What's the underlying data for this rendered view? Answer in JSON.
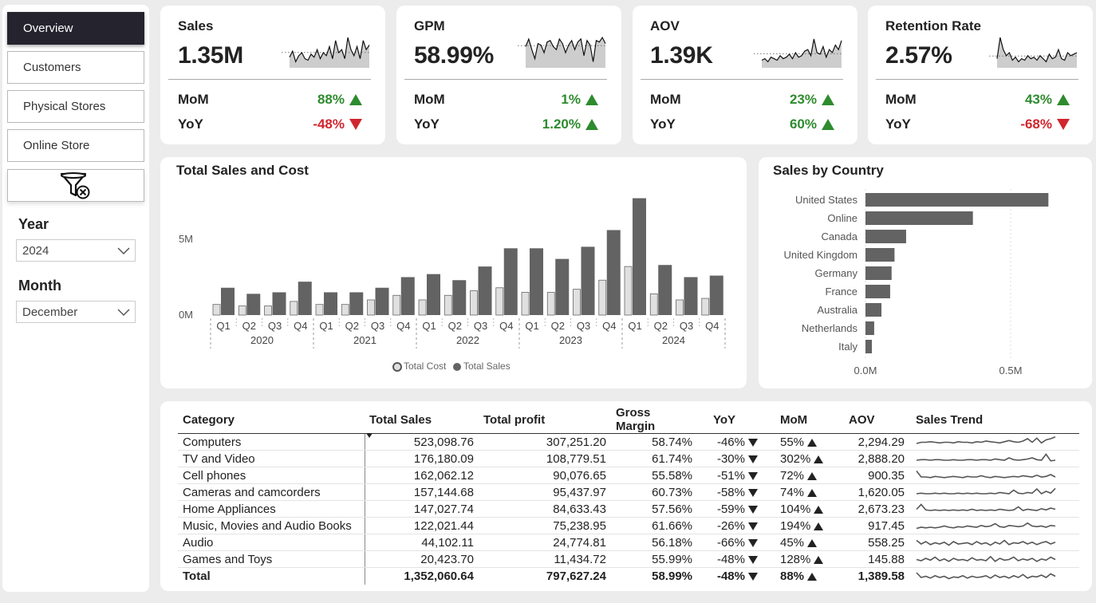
{
  "nav": {
    "items": [
      {
        "label": "Overview",
        "active": true
      },
      {
        "label": "Customers",
        "active": false
      },
      {
        "label": "Physical Stores",
        "active": false
      },
      {
        "label": "Online Store",
        "active": false
      }
    ],
    "clear_filter_icon": "funnel-clear-icon"
  },
  "filters": {
    "year": {
      "label": "Year",
      "value": "2024"
    },
    "month": {
      "label": "Month",
      "value": "December"
    }
  },
  "kpis": [
    {
      "title": "Sales",
      "value": "1.35M",
      "mom_label": "MoM",
      "mom": "88%",
      "mom_dir": "up",
      "yoy_label": "YoY",
      "yoy": "-48%",
      "yoy_dir": "down",
      "trend": [
        0.35,
        0.55,
        0.2,
        0.4,
        0.5,
        0.3,
        0.25,
        0.45,
        0.35,
        0.6,
        0.3,
        0.5,
        0.4,
        0.7,
        0.3,
        0.9,
        0.5,
        0.6,
        0.3,
        1.0,
        0.6,
        0.4,
        0.7,
        0.3,
        0.9,
        0.6,
        0.75
      ]
    },
    {
      "title": "GPM",
      "value": "58.99%",
      "mom_label": "MoM",
      "mom": "1%",
      "mom_dir": "up",
      "yoy_label": "YoY",
      "yoy": "1.20%",
      "yoy_dir": "up",
      "trend": [
        0.7,
        0.95,
        0.6,
        0.3,
        0.8,
        0.75,
        0.5,
        0.85,
        0.9,
        0.7,
        0.6,
        0.95,
        0.8,
        0.5,
        0.75,
        0.9,
        0.6,
        0.85,
        0.95,
        0.4,
        0.9,
        0.75,
        0.2,
        0.9,
        0.85,
        1.0,
        0.8
      ]
    },
    {
      "title": "AOV",
      "value": "1.39K",
      "mom_label": "MoM",
      "mom": "23%",
      "mom_dir": "up",
      "yoy_label": "YoY",
      "yoy": "60%",
      "yoy_dir": "up",
      "trend": [
        0.25,
        0.3,
        0.2,
        0.35,
        0.3,
        0.25,
        0.4,
        0.3,
        0.35,
        0.45,
        0.3,
        0.5,
        0.35,
        0.4,
        0.55,
        0.6,
        0.4,
        0.95,
        0.5,
        0.45,
        0.7,
        0.35,
        0.6,
        0.5,
        0.75,
        0.6,
        0.9
      ]
    },
    {
      "title": "Retention Rate",
      "value": "2.57%",
      "mom_label": "MoM",
      "mom": "43%",
      "mom_dir": "up",
      "yoy_label": "YoY",
      "yoy": "-68%",
      "yoy_dir": "down",
      "trend": [
        0.3,
        1.0,
        0.6,
        0.4,
        0.5,
        0.25,
        0.35,
        0.2,
        0.3,
        0.25,
        0.4,
        0.3,
        0.35,
        0.25,
        0.4,
        0.3,
        0.2,
        0.45,
        0.3,
        0.35,
        0.6,
        0.3,
        0.25,
        0.5,
        0.4,
        0.45,
        0.5
      ]
    }
  ],
  "chart_data": [
    {
      "type": "bar",
      "title": "Total Sales and Cost",
      "y_tick_labels": [
        "0M",
        "5M"
      ],
      "ylim": [
        0,
        8.2
      ],
      "quarters": [
        "Q1",
        "Q2",
        "Q3",
        "Q4",
        "Q1",
        "Q2",
        "Q3",
        "Q4",
        "Q1",
        "Q2",
        "Q3",
        "Q4",
        "Q1",
        "Q2",
        "Q3",
        "Q4",
        "Q1",
        "Q2",
        "Q3",
        "Q4"
      ],
      "years": [
        "2020",
        "2021",
        "2022",
        "2023",
        "2024"
      ],
      "series": [
        {
          "name": "Total Cost",
          "color": "#e0e0e0",
          "values": [
            0.7,
            0.6,
            0.6,
            0.9,
            0.7,
            0.7,
            1.0,
            1.3,
            1.0,
            1.3,
            1.6,
            1.8,
            1.5,
            1.5,
            1.7,
            2.3,
            3.2,
            1.4,
            1.0,
            1.1
          ]
        },
        {
          "name": "Total Sales",
          "color": "#636363",
          "values": [
            1.8,
            1.4,
            1.5,
            2.2,
            1.5,
            1.5,
            1.8,
            2.5,
            2.7,
            2.3,
            3.2,
            4.4,
            4.4,
            3.7,
            4.5,
            5.6,
            7.7,
            3.3,
            2.5,
            2.6
          ]
        }
      ],
      "legend": "bottom",
      "grid": false
    },
    {
      "type": "bar",
      "orientation": "horizontal",
      "title": "Sales by Country",
      "categories": [
        "United States",
        "Online",
        "Canada",
        "United Kingdom",
        "Germany",
        "France",
        "Australia",
        "Netherlands",
        "Italy"
      ],
      "values": [
        0.63,
        0.37,
        0.14,
        0.1,
        0.09,
        0.085,
        0.055,
        0.03,
        0.022
      ],
      "x_tick_labels": [
        "0.0M",
        "0.5M"
      ],
      "xlim": [
        0,
        0.75
      ],
      "color": "#636363"
    }
  ],
  "table": {
    "headers": [
      "Category",
      "Total Sales",
      "Total profit",
      "Gross Margin",
      "YoY",
      "MoM",
      "AOV",
      "Sales Trend"
    ],
    "rows": [
      {
        "category": "Computers",
        "sales": "523,098.76",
        "profit": "307,251.20",
        "margin": "58.74%",
        "yoy": "-46%",
        "yoy_dir": "down",
        "mom": "55%",
        "mom_dir": "up",
        "aov": "2,294.29",
        "trend": [
          0.4,
          0.5,
          0.5,
          0.55,
          0.5,
          0.45,
          0.5,
          0.5,
          0.45,
          0.55,
          0.5,
          0.5,
          0.45,
          0.55,
          0.5,
          0.6,
          0.55,
          0.5,
          0.45,
          0.55,
          0.65,
          0.55,
          0.5,
          0.6,
          0.8,
          0.5,
          0.85,
          0.45,
          0.7,
          0.8,
          0.95
        ]
      },
      {
        "category": "TV and Video",
        "sales": "176,180.09",
        "profit": "108,779.51",
        "margin": "61.74%",
        "yoy": "-30%",
        "yoy_dir": "down",
        "mom": "302%",
        "mom_dir": "up",
        "aov": "2,888.20",
        "trend": [
          0.4,
          0.45,
          0.45,
          0.4,
          0.45,
          0.45,
          0.4,
          0.4,
          0.45,
          0.4,
          0.4,
          0.45,
          0.45,
          0.4,
          0.45,
          0.45,
          0.4,
          0.5,
          0.45,
          0.4,
          0.6,
          0.45,
          0.4,
          0.45,
          0.5,
          0.6,
          0.45,
          0.4,
          0.9,
          0.35,
          0.4
        ]
      },
      {
        "category": "Cell phones",
        "sales": "162,062.12",
        "profit": "90,076.65",
        "margin": "55.58%",
        "yoy": "-51%",
        "yoy_dir": "down",
        "mom": "72%",
        "mom_dir": "up",
        "aov": "900.35",
        "trend": [
          0.9,
          0.4,
          0.4,
          0.35,
          0.45,
          0.4,
          0.35,
          0.4,
          0.45,
          0.4,
          0.35,
          0.45,
          0.4,
          0.4,
          0.5,
          0.4,
          0.35,
          0.45,
          0.4,
          0.35,
          0.4,
          0.45,
          0.4,
          0.5,
          0.45,
          0.4,
          0.55,
          0.4,
          0.45,
          0.6,
          0.4
        ]
      },
      {
        "category": "Cameras and camcorders",
        "sales": "157,144.68",
        "profit": "95,437.97",
        "margin": "60.73%",
        "yoy": "-58%",
        "yoy_dir": "down",
        "mom": "74%",
        "mom_dir": "up",
        "aov": "1,620.05",
        "trend": [
          0.4,
          0.45,
          0.4,
          0.4,
          0.45,
          0.4,
          0.45,
          0.4,
          0.4,
          0.45,
          0.4,
          0.45,
          0.4,
          0.45,
          0.4,
          0.4,
          0.45,
          0.4,
          0.5,
          0.45,
          0.4,
          0.7,
          0.45,
          0.4,
          0.5,
          0.45,
          0.8,
          0.4,
          0.6,
          0.45,
          0.85
        ]
      },
      {
        "category": "Home Appliances",
        "sales": "147,027.74",
        "profit": "84,633.43",
        "margin": "57.56%",
        "yoy": "-59%",
        "yoy_dir": "down",
        "mom": "104%",
        "mom_dir": "up",
        "aov": "2,673.23",
        "trend": [
          0.5,
          0.9,
          0.45,
          0.4,
          0.45,
          0.4,
          0.45,
          0.4,
          0.45,
          0.4,
          0.45,
          0.4,
          0.5,
          0.4,
          0.45,
          0.4,
          0.45,
          0.4,
          0.5,
          0.45,
          0.4,
          0.45,
          0.7,
          0.4,
          0.5,
          0.45,
          0.4,
          0.55,
          0.45,
          0.6,
          0.5
        ]
      },
      {
        "category": "Music, Movies and Audio Books",
        "sales": "122,021.44",
        "profit": "75,238.95",
        "margin": "61.66%",
        "yoy": "-26%",
        "yoy_dir": "down",
        "mom": "194%",
        "mom_dir": "up",
        "aov": "917.45",
        "trend": [
          0.3,
          0.4,
          0.35,
          0.4,
          0.35,
          0.4,
          0.5,
          0.4,
          0.35,
          0.45,
          0.4,
          0.5,
          0.45,
          0.4,
          0.55,
          0.45,
          0.5,
          0.7,
          0.45,
          0.4,
          0.55,
          0.5,
          0.45,
          0.5,
          0.75,
          0.5,
          0.45,
          0.5,
          0.4,
          0.55,
          0.5
        ]
      },
      {
        "category": "Audio",
        "sales": "44,102.11",
        "profit": "24,774.81",
        "margin": "56.18%",
        "yoy": "-66%",
        "yoy_dir": "down",
        "mom": "45%",
        "mom_dir": "up",
        "aov": "558.25",
        "trend": [
          0.7,
          0.4,
          0.6,
          0.35,
          0.5,
          0.4,
          0.55,
          0.3,
          0.6,
          0.4,
          0.45,
          0.5,
          0.35,
          0.6,
          0.4,
          0.5,
          0.3,
          0.55,
          0.4,
          0.7,
          0.35,
          0.5,
          0.45,
          0.6,
          0.4,
          0.55,
          0.35,
          0.5,
          0.6,
          0.4,
          0.55
        ]
      },
      {
        "category": "Games and Toys",
        "sales": "20,423.70",
        "profit": "11,434.72",
        "margin": "55.99%",
        "yoy": "-48%",
        "yoy_dir": "down",
        "mom": "128%",
        "mom_dir": "up",
        "aov": "145.88",
        "trend": [
          0.5,
          0.4,
          0.6,
          0.45,
          0.7,
          0.4,
          0.55,
          0.35,
          0.6,
          0.45,
          0.5,
          0.4,
          0.65,
          0.45,
          0.5,
          0.4,
          0.75,
          0.35,
          0.6,
          0.45,
          0.5,
          0.7,
          0.4,
          0.55,
          0.45,
          0.6,
          0.35,
          0.55,
          0.45,
          0.7,
          0.5
        ]
      },
      {
        "category": "Total",
        "sales": "1,352,060.64",
        "profit": "797,627.24",
        "margin": "58.99%",
        "yoy": "-48%",
        "yoy_dir": "down",
        "mom": "88%",
        "mom_dir": "up",
        "aov": "1,389.58",
        "trend": [
          0.8,
          0.4,
          0.5,
          0.35,
          0.55,
          0.4,
          0.5,
          0.3,
          0.45,
          0.4,
          0.55,
          0.35,
          0.5,
          0.4,
          0.45,
          0.55,
          0.35,
          0.6,
          0.4,
          0.5,
          0.35,
          0.55,
          0.4,
          0.65,
          0.35,
          0.5,
          0.45,
          0.6,
          0.4,
          0.7,
          0.5
        ]
      }
    ]
  },
  "colors": {
    "up": "#2e8b2e",
    "down": "#d0262e",
    "bar": "#636363",
    "bar_light": "#e0e0e0",
    "nav_active": "#25232e"
  }
}
